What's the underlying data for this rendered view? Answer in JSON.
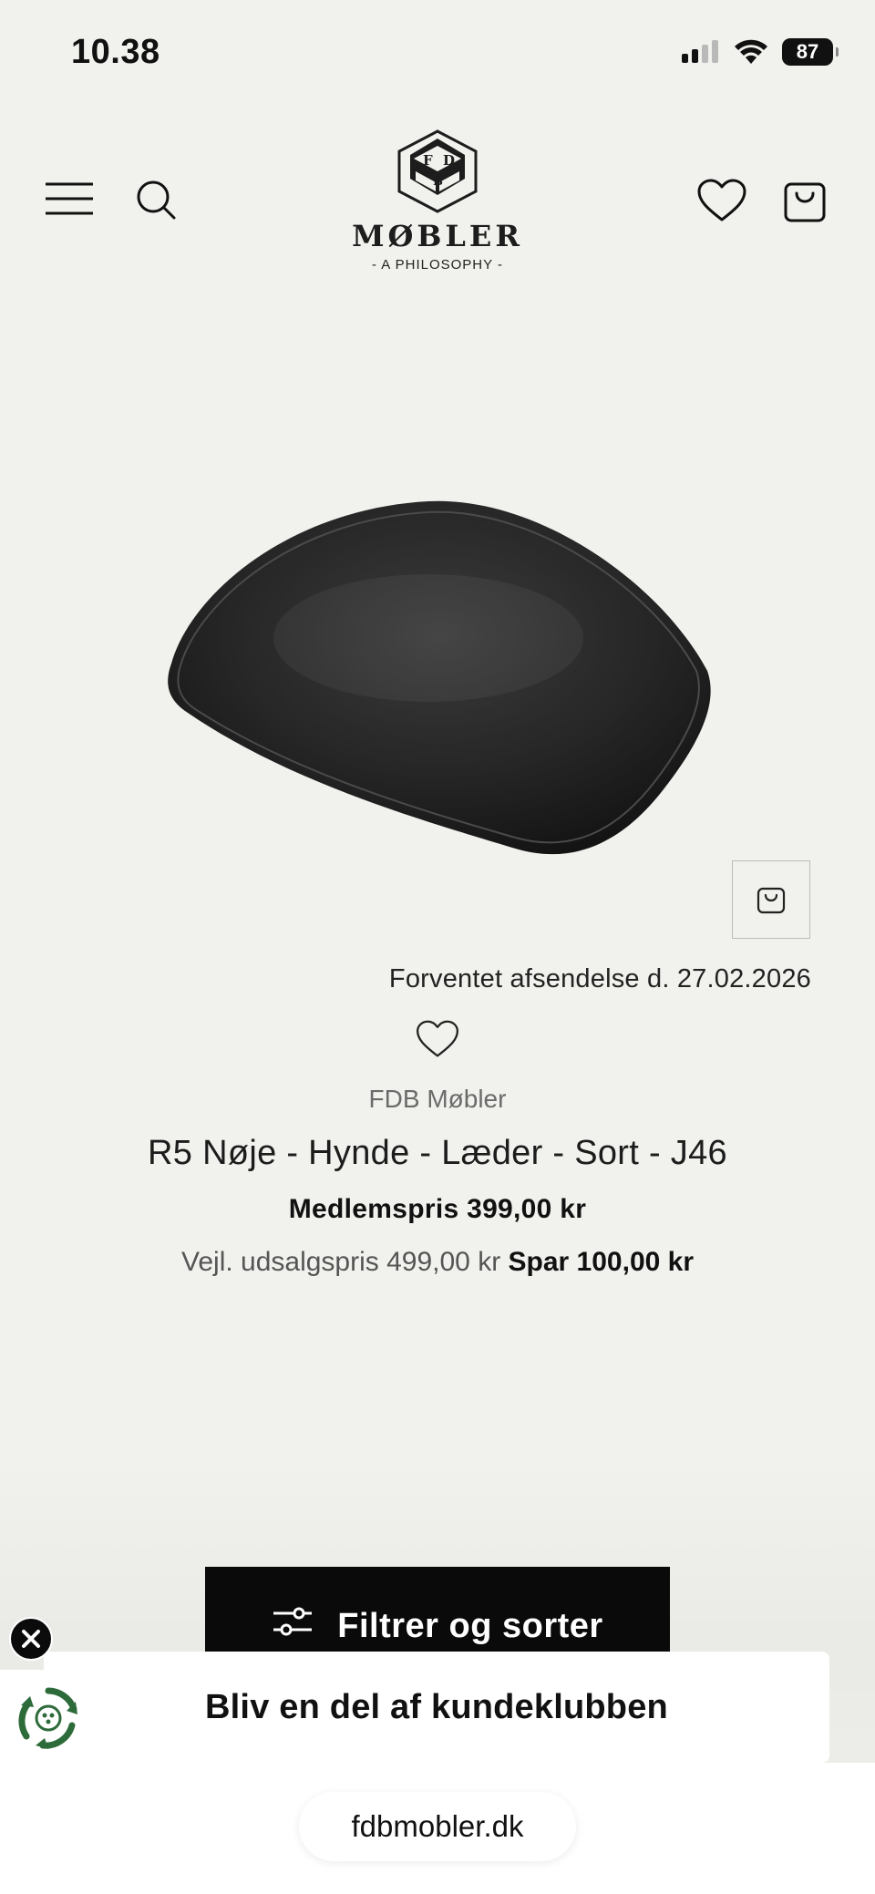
{
  "status_bar": {
    "time": "10.38",
    "battery": "87"
  },
  "header": {
    "logo_letters": [
      "F",
      "D",
      "B"
    ],
    "logo_word": "MØBLER",
    "logo_tagline": "- A PHILOSOPHY -",
    "icons": [
      "menu-icon",
      "search-icon",
      "heart-icon",
      "bag-icon"
    ]
  },
  "product": {
    "shipping": "Forventet afsendelse d. 27.02.2026",
    "brand": "FDB Møbler",
    "name": "R5 Nøje - Hynde - Læder - Sort - J46",
    "member_price": "Medlemspris 399,00 kr",
    "rrp": "Vejl. udsalgspris 499,00 kr",
    "saving": "Spar 100,00 kr"
  },
  "filter": {
    "label": "Filtrer og sorter"
  },
  "club": {
    "label": "Bliv en del af kundeklubben"
  },
  "browser": {
    "url": "fdbmobler.dk"
  },
  "colors": {
    "background": "#f1f1ed",
    "button": "#0a0a0a",
    "badge_green": "#2e6b3a"
  }
}
